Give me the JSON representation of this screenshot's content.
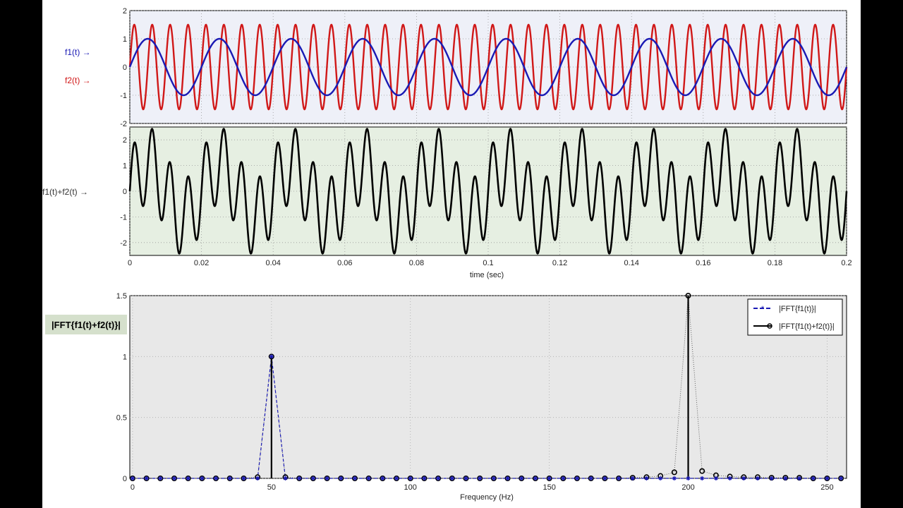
{
  "colors": {
    "f1": "#1a1ab4",
    "f2": "#d01818",
    "sum": "#000000",
    "panel1_bg": "#eef0f8",
    "panel2_bg": "#e6efe2",
    "panel3_bg": "#e8e8e8",
    "fft_label_bg": "#d5e0cc",
    "page_bg": "#000000"
  },
  "labels": {
    "f1": "f1(t) →",
    "f2": "f2(t) →",
    "sum": "f1(t)+f2(t) →",
    "fft": "|FFT{f1(t)+f2(t)}|"
  },
  "chart_data": [
    {
      "type": "line",
      "title": "",
      "xlabel": "",
      "ylabel": "",
      "xlim": [
        0,
        0.2
      ],
      "ylim": [
        -2,
        2
      ],
      "yticks": [
        -2,
        -1,
        0,
        1,
        2
      ],
      "grid": true,
      "series": [
        {
          "name": "f1(t)",
          "function": "sine",
          "amplitude": 1.0,
          "frequency_hz": 50
        },
        {
          "name": "f2(t)",
          "function": "sine",
          "amplitude": 1.5,
          "frequency_hz": 200
        }
      ]
    },
    {
      "type": "line",
      "title": "",
      "xlabel": "time (sec)",
      "ylabel": "",
      "xlim": [
        0,
        0.2
      ],
      "ylim": [
        -2.5,
        2.5
      ],
      "xticks": [
        0,
        0.02,
        0.04,
        0.06,
        0.08,
        0.1,
        0.12,
        0.14,
        0.16,
        0.18,
        0.2
      ],
      "xtick_labels": [
        "0",
        "0.02",
        "0.04",
        "0.06",
        "0.08",
        "0.1",
        "0.12",
        "0.14",
        "0.16",
        "0.18",
        "0.2"
      ],
      "yticks": [
        -2,
        -1,
        0,
        1,
        2
      ],
      "grid": true,
      "series": [
        {
          "name": "f1(t)+f2(t)",
          "function": "sine_sum",
          "components": [
            {
              "amplitude": 1.0,
              "frequency_hz": 50
            },
            {
              "amplitude": 1.5,
              "frequency_hz": 200
            }
          ]
        }
      ]
    },
    {
      "type": "stem",
      "title": "",
      "xlabel": "Frequency (Hz)",
      "ylabel": "",
      "xlim": [
        -1,
        257
      ],
      "ylim": [
        0,
        1.5
      ],
      "xticks": [
        0,
        50,
        100,
        150,
        200,
        250
      ],
      "yticks": [
        0,
        0.5,
        1,
        1.5
      ],
      "ytick_labels": [
        "0",
        "0.5",
        "1",
        "1.5"
      ],
      "grid": true,
      "legend": "top-right",
      "legend_entries": [
        "|FFT{f1(t)}|",
        "|FFT{f1(t)+f2(t)}|"
      ],
      "frequency_step_hz": 5,
      "frequency_max_hz": 255,
      "series": [
        {
          "name": "|FFT{f1(t)}|",
          "x": [
            0,
            5,
            10,
            15,
            20,
            25,
            30,
            35,
            40,
            45,
            50,
            55,
            60,
            65,
            70,
            75,
            80,
            85,
            90,
            95,
            100,
            105,
            110,
            115,
            120,
            125,
            130,
            135,
            140,
            145,
            150,
            155,
            160,
            165,
            170,
            175,
            180,
            185,
            190,
            195,
            200,
            205,
            210,
            215,
            220,
            225,
            230,
            235,
            240,
            245,
            250,
            255
          ],
          "values": [
            0,
            0,
            0,
            0,
            0,
            0,
            0,
            0,
            0,
            0,
            1.0,
            0,
            0,
            0,
            0,
            0,
            0,
            0,
            0,
            0,
            0,
            0,
            0,
            0,
            0,
            0,
            0,
            0,
            0,
            0,
            0,
            0,
            0,
            0,
            0,
            0,
            0,
            0,
            0,
            0,
            0,
            0,
            0,
            0,
            0,
            0,
            0,
            0,
            0,
            0,
            0,
            0
          ]
        },
        {
          "name": "|FFT{f1(t)+f2(t)}|",
          "x": [
            0,
            5,
            10,
            15,
            20,
            25,
            30,
            35,
            40,
            45,
            50,
            55,
            60,
            65,
            70,
            75,
            80,
            85,
            90,
            95,
            100,
            105,
            110,
            115,
            120,
            125,
            130,
            135,
            140,
            145,
            150,
            155,
            160,
            165,
            170,
            175,
            180,
            185,
            190,
            195,
            200,
            205,
            210,
            215,
            220,
            225,
            230,
            235,
            240,
            245,
            250,
            255
          ],
          "values": [
            0,
            0,
            0,
            0,
            0,
            0,
            0,
            0,
            0,
            0.01,
            1.0,
            0.01,
            0,
            0,
            0,
            0,
            0,
            0,
            0,
            0,
            0,
            0,
            0,
            0,
            0,
            0,
            0,
            0,
            0,
            0,
            0,
            0,
            0,
            0,
            0,
            0,
            0.005,
            0.01,
            0.02,
            0.05,
            1.5,
            0.06,
            0.025,
            0.015,
            0.01,
            0.01,
            0.005,
            0.005,
            0.005,
            0,
            0,
            0
          ]
        }
      ]
    }
  ]
}
